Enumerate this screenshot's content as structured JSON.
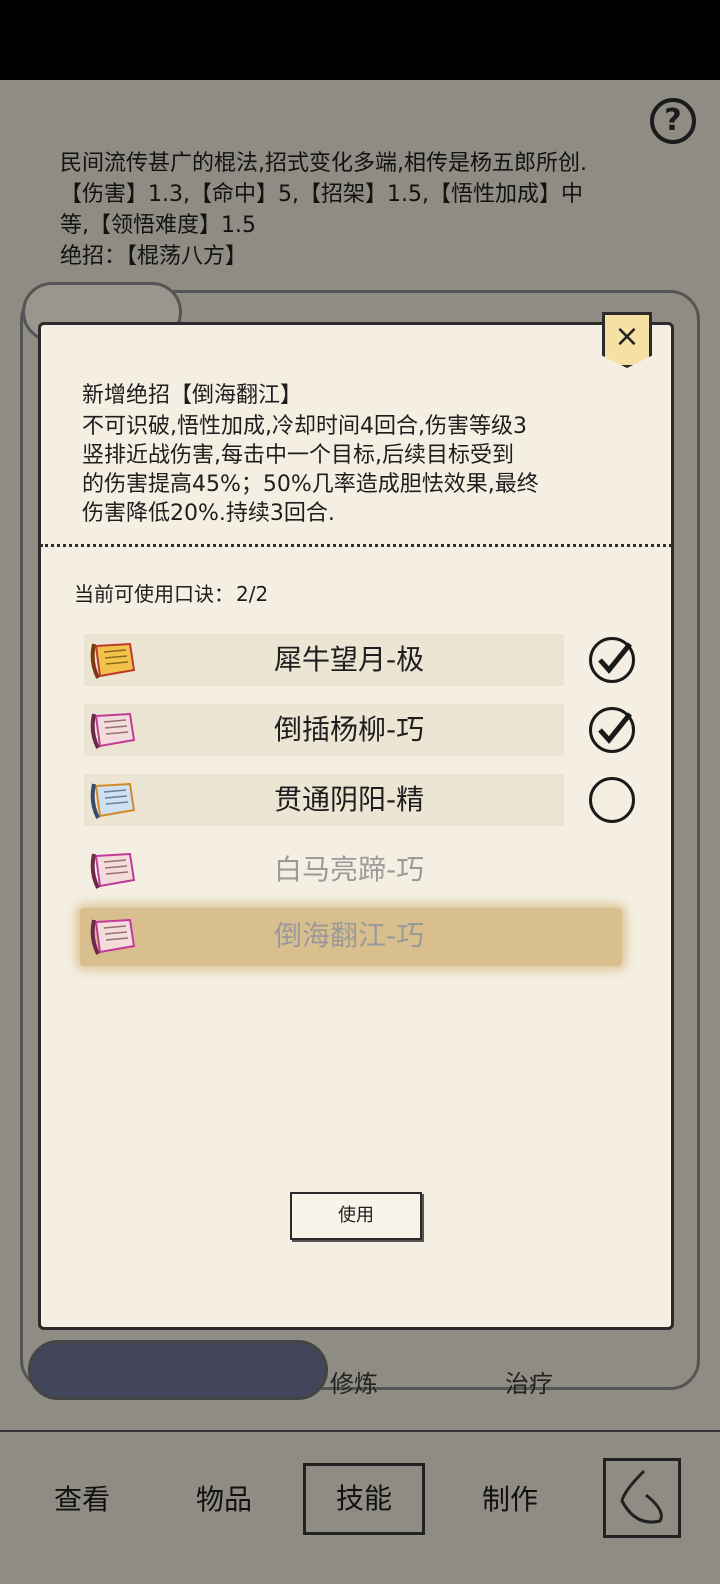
{
  "background": {
    "description_lines": [
      "民间流传甚广的棍法,招式变化多端,相传是杨五郎所创.",
      "【伤害】1.3,【命中】5,【招架】1.5,【悟性加成】中",
      "等,【领悟难度】1.5",
      "绝招：【棍荡八方】"
    ],
    "partial_left": "修炼",
    "partial_right": "治疗"
  },
  "modal": {
    "new_title": "新增绝招【倒海翻江】",
    "new_desc_lines": [
      "不可识破,悟性加成,冷却时间4回合,伤害等级3",
      "竖排近战伤害,每击中一个目标,后续目标受到",
      "的伤害提高45%；50%几率造成胆怯效果,最终",
      "伤害降低20%.持续3回合."
    ],
    "usable_label": "当前可使用口诀：",
    "usable_count": "2/2",
    "items": [
      {
        "label": "犀牛望月-极",
        "icon": "scroll-gold-icon",
        "state": "checked"
      },
      {
        "label": "倒插杨柳-巧",
        "icon": "scroll-pink-icon",
        "state": "checked"
      },
      {
        "label": "贯通阴阳-精",
        "icon": "scroll-blue-icon",
        "state": "unchecked"
      },
      {
        "label": "白马亮蹄-巧",
        "icon": "scroll-pink-icon",
        "state": "disabled"
      },
      {
        "label": "倒海翻江-巧",
        "icon": "scroll-pink-icon",
        "state": "selected-disabled"
      }
    ],
    "use_button": "使用",
    "close_symbol": "×"
  },
  "help_symbol": "?",
  "tabs": [
    {
      "label": "查看"
    },
    {
      "label": "物品"
    },
    {
      "label": "技能",
      "active": true
    },
    {
      "label": "制作"
    }
  ],
  "colors": {
    "modal_bg": "#f4efe2",
    "selected_row": "#d9bf8e",
    "disabled_text": "#9a9a9a"
  }
}
